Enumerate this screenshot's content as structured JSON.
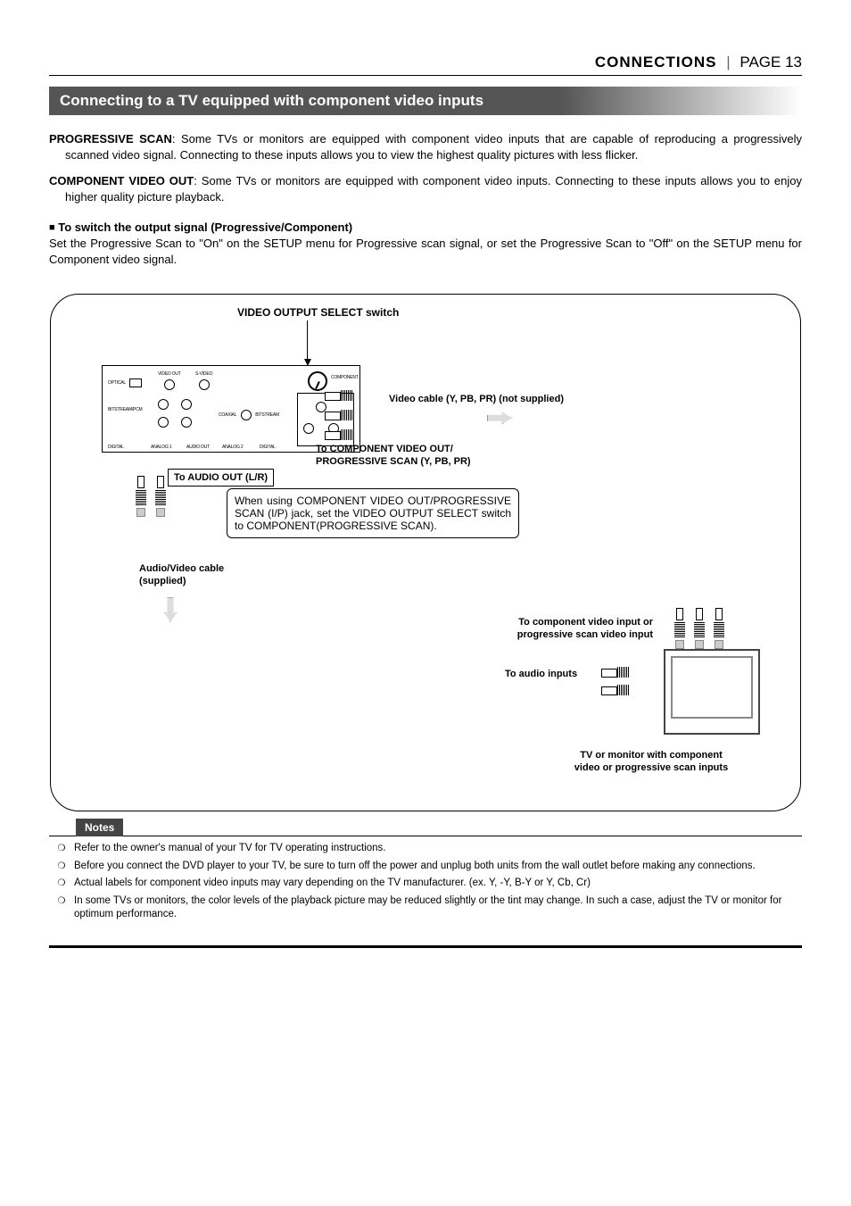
{
  "header": {
    "section": "CONNECTIONS",
    "page_label": "PAGE 13"
  },
  "section_title": "Connecting to a TV equipped with component video inputs",
  "para_progressive": {
    "lead": "PROGRESSIVE SCAN",
    "text": ": Some TVs or monitors are equipped with component video inputs that are capable of reproducing a progressively scanned video signal. Connecting to these inputs allows you to view the highest quality pictures with less flicker."
  },
  "para_component": {
    "lead": "COMPONENT VIDEO OUT",
    "text": ": Some TVs or monitors are equipped with component video inputs. Connecting to these inputs allows you to enjoy higher quality picture playback."
  },
  "switch_heading": "To switch the output signal (Progressive/Component)",
  "switch_text": "Set the Progressive Scan to \"On\" on the SETUP menu for Progressive scan signal, or set the Progressive Scan to \"Off\" on the SETUP menu for Component video signal.",
  "diagram": {
    "video_output_select": "VIDEO OUTPUT SELECT switch",
    "video_cable": "Video cable (Y, PB, PR) (not supplied)",
    "to_component_line1": "To COMPONENT VIDEO OUT/",
    "to_component_line2": "PROGRESSIVE SCAN (Y, PB, PR)",
    "to_audio_out": "To AUDIO OUT (L/R)",
    "callout_text": "When using COMPONENT VIDEO OUT/PROGRESSIVE SCAN (I/P) jack, set the VIDEO OUTPUT SELECT switch to COMPONENT(PROGRESSIVE SCAN).",
    "av_cable_line1": "Audio/Video cable",
    "av_cable_line2": "(supplied)",
    "to_component_input_line1": "To component video input or",
    "to_component_input_line2": "progressive scan video input",
    "to_audio_inputs": "To audio inputs",
    "tv_caption_line1": "TV or monitor with component",
    "tv_caption_line2": "video or progressive scan inputs",
    "panel_labels": {
      "optical": "OPTICAL",
      "video_out": "VIDEO OUT",
      "sv": "S-VIDEO",
      "bitstream_pcm": "BITSTREAM/PCM",
      "coaxial": "COAXIAL",
      "bitstream": "BITSTREAM",
      "digital": "DIGITAL",
      "analog1": "ANALOG 1",
      "analog2": "ANALOG 2",
      "audio_out": "AUDIO OUT",
      "component": "COMPONENT"
    }
  },
  "notes": {
    "heading": "Notes",
    "items": [
      "Refer to the owner's manual of your TV for TV operating instructions.",
      "Before you connect the DVD player to your TV, be sure to turn off the power and unplug both units from the wall outlet before making any connections.",
      "Actual labels for component video inputs may vary depending on the TV manufacturer. (ex. Y, -Y, B-Y or Y, Cb, Cr)",
      "In some TVs or monitors, the color levels of the playback picture may be reduced slightly or the tint may change. In such a case, adjust the TV or monitor for optimum performance."
    ]
  }
}
